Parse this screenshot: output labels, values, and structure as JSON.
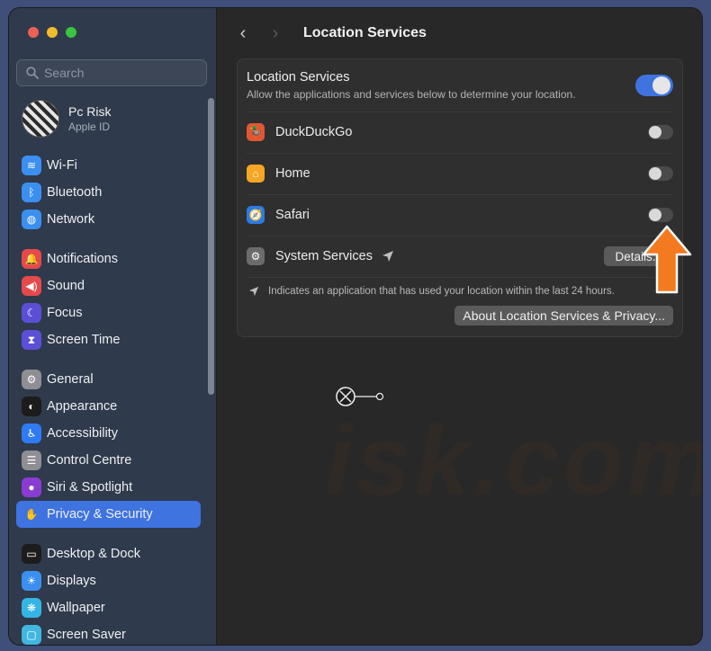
{
  "sidebar": {
    "search_placeholder": "Search",
    "account": {
      "name": "Pc Risk",
      "subtitle": "Apple ID"
    },
    "items": [
      {
        "label": "Wi-Fi",
        "icon": "wifi-icon",
        "color": "#3a8ff0",
        "glyph": "≋"
      },
      {
        "label": "Bluetooth",
        "icon": "bluetooth-icon",
        "color": "#3a8ff0",
        "glyph": "ᛒ"
      },
      {
        "label": "Network",
        "icon": "globe-icon",
        "color": "#3a8ff0",
        "glyph": "◍"
      },
      {
        "label": "Notifications",
        "icon": "bell-icon",
        "color": "#e6494b",
        "glyph": "🔔"
      },
      {
        "label": "Sound",
        "icon": "speaker-icon",
        "color": "#e6494b",
        "glyph": "◀)"
      },
      {
        "label": "Focus",
        "icon": "moon-icon",
        "color": "#5b4fd6",
        "glyph": "☾"
      },
      {
        "label": "Screen Time",
        "icon": "hourglass-icon",
        "color": "#5b4fd6",
        "glyph": "⧗"
      },
      {
        "label": "General",
        "icon": "gear-icon",
        "color": "#8e8e93",
        "glyph": "⚙"
      },
      {
        "label": "Appearance",
        "icon": "appearance-icon",
        "color": "#1c1c1c",
        "glyph": "◐"
      },
      {
        "label": "Accessibility",
        "icon": "accessibility-icon",
        "color": "#2f7bf5",
        "glyph": "♿"
      },
      {
        "label": "Control Centre",
        "icon": "control-centre-icon",
        "color": "#8e8e93",
        "glyph": "☰"
      },
      {
        "label": "Siri & Spotlight",
        "icon": "siri-icon",
        "color": "#8a3bd1",
        "glyph": "●"
      },
      {
        "label": "Privacy & Security",
        "icon": "hand-icon",
        "color": "#3f73e0",
        "glyph": "✋"
      },
      {
        "label": "Desktop & Dock",
        "icon": "dock-icon",
        "color": "#1c1c1c",
        "glyph": "▭"
      },
      {
        "label": "Displays",
        "icon": "sun-icon",
        "color": "#3a8ff0",
        "glyph": "☀"
      },
      {
        "label": "Wallpaper",
        "icon": "flower-icon",
        "color": "#35b5e6",
        "glyph": "❋"
      },
      {
        "label": "Screen Saver",
        "icon": "screen-saver-icon",
        "color": "#40b7e0",
        "glyph": "▢"
      }
    ],
    "active": "Privacy & Security"
  },
  "toolbar": {
    "back": "‹",
    "forward": "›",
    "title": "Location Services"
  },
  "location": {
    "header": {
      "title": "Location Services",
      "subtitle": "Allow the applications and services below to determine your location.",
      "enabled": true
    },
    "apps": [
      {
        "name": "DuckDuckGo",
        "icon": "duckduckgo-icon",
        "color": "#de5833",
        "glyph": "🦆",
        "enabled": false
      },
      {
        "name": "Home",
        "icon": "home-icon",
        "color": "#f5a623",
        "glyph": "⌂",
        "enabled": false
      },
      {
        "name": "Safari",
        "icon": "safari-icon",
        "color": "#2c7be5",
        "glyph": "🧭",
        "enabled": false
      }
    ],
    "system_services": {
      "name": "System Services",
      "details_label": "Details..."
    },
    "note": "Indicates an application that has used your location within the last 24 hours.",
    "about_label": "About Location Services & Privacy..."
  },
  "colors": {
    "accent": "#3f73e0",
    "highlight_arrow": "#f47a20"
  }
}
